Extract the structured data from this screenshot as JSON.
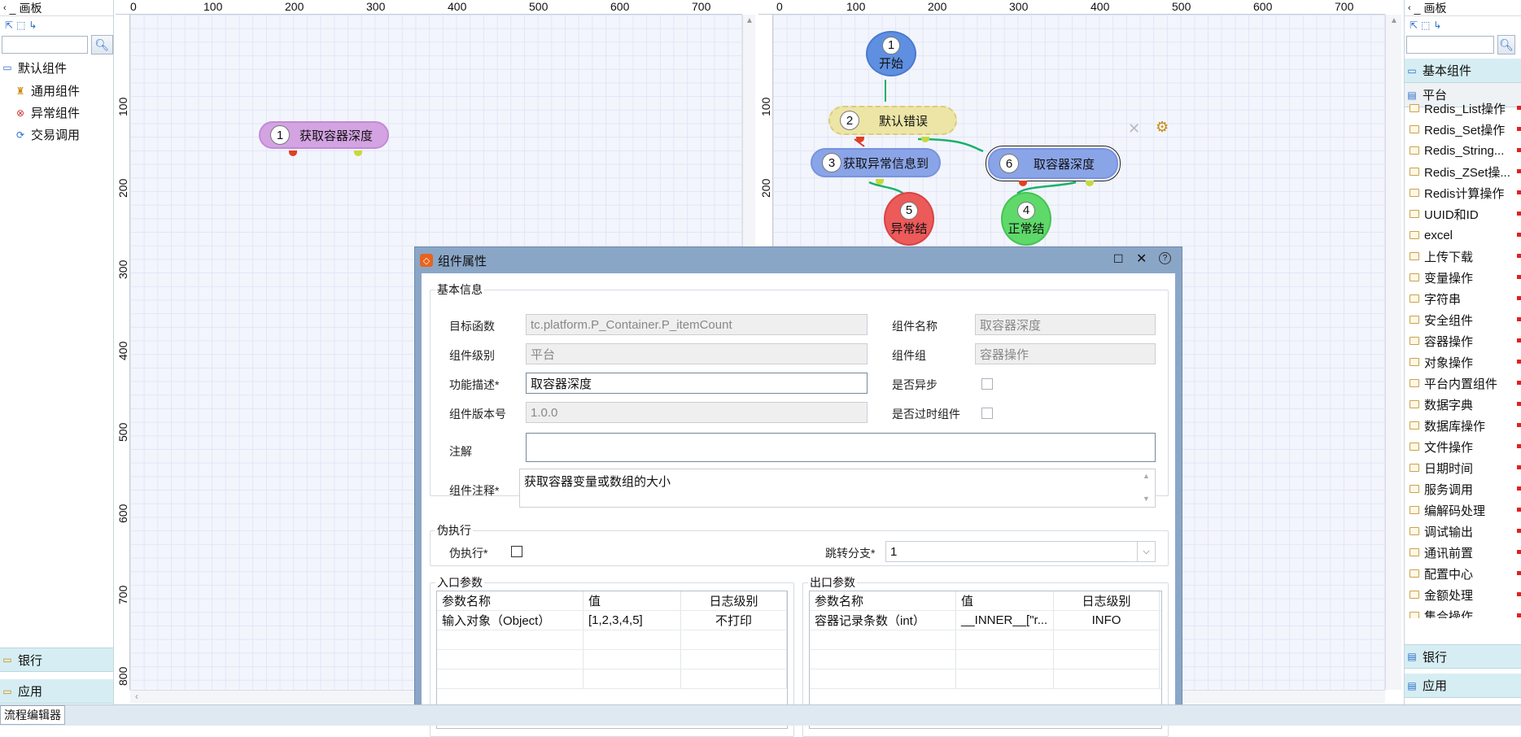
{
  "left_palette": {
    "title": "画板",
    "root": "默认组件",
    "items": [
      "通用组件",
      "异常组件",
      "交易调用"
    ],
    "bottom": [
      "银行",
      "应用"
    ]
  },
  "right_palette": {
    "title": "画板",
    "cat1": "基本组件",
    "cat2": "平台",
    "items": [
      "Redis_List操作",
      "Redis_Set操作",
      "Redis_String...",
      "Redis_ZSet操...",
      "Redis计算操作",
      "UUID和ID",
      "excel",
      "上传下载",
      "变量操作",
      "字符串",
      "安全组件",
      "容器操作",
      "对象操作",
      "平台内置组件",
      "数据字典",
      "数据库操作",
      "文件操作",
      "日期时间",
      "服务调用",
      "编解码处理",
      "调试输出",
      "通讯前置",
      "配置中心",
      "金额处理",
      "集合操作"
    ],
    "bottom": [
      "银行",
      "应用"
    ]
  },
  "ruler_x": [
    "0",
    "100",
    "200",
    "300",
    "400",
    "500",
    "600",
    "700"
  ],
  "ruler_y": [
    "100",
    "200",
    "300",
    "400",
    "500",
    "600",
    "700",
    "800"
  ],
  "canvas1": {
    "node": {
      "num": "1",
      "label": "获取容器深度"
    }
  },
  "canvas2": {
    "start": {
      "num": "1",
      "label": "开始"
    },
    "err": {
      "num": "2",
      "label": "默认错误"
    },
    "getex": {
      "num": "3",
      "label": "获取异常信息到"
    },
    "depth": {
      "num": "6",
      "label": "取容器深度"
    },
    "exend": {
      "num": "5",
      "label": "异常结"
    },
    "okend": {
      "num": "4",
      "label": "正常结"
    }
  },
  "dialog": {
    "title": "组件属性",
    "basic_legend": "基本信息",
    "target_fn_label": "目标函数",
    "target_fn": "tc.platform.P_Container.P_itemCount",
    "comp_name_label": "组件名称",
    "comp_name": "取容器深度",
    "level_label": "组件级别",
    "level": "平台",
    "group_label": "组件组",
    "group": "容器操作",
    "desc_label": "功能描述*",
    "desc": "取容器深度",
    "async_label": "是否异步",
    "version_label": "组件版本号",
    "version": "1.0.0",
    "obsolete_label": "是否过时组件",
    "note_label": "注解",
    "note": "",
    "comment_label": "组件注释*",
    "comment": "获取容器变量或数组的大小",
    "fake_legend": "伪执行",
    "fake_label": "伪执行*",
    "branch_label": "跳转分支*",
    "branch": "1",
    "in_legend": "入口参数",
    "out_legend": "出口参数",
    "in_headers": [
      "参数名称",
      "值",
      "日志级别"
    ],
    "in_rows": [
      [
        "输入对象（Object）",
        "[1,2,3,4,5]",
        "不打印"
      ]
    ],
    "out_headers": [
      "参数名称",
      "值",
      "日志级别"
    ],
    "out_rows": [
      [
        "容器记录条数（int）",
        "__INNER__[\"r...",
        "INFO"
      ]
    ]
  },
  "status": {
    "tab": "流程编辑器"
  }
}
